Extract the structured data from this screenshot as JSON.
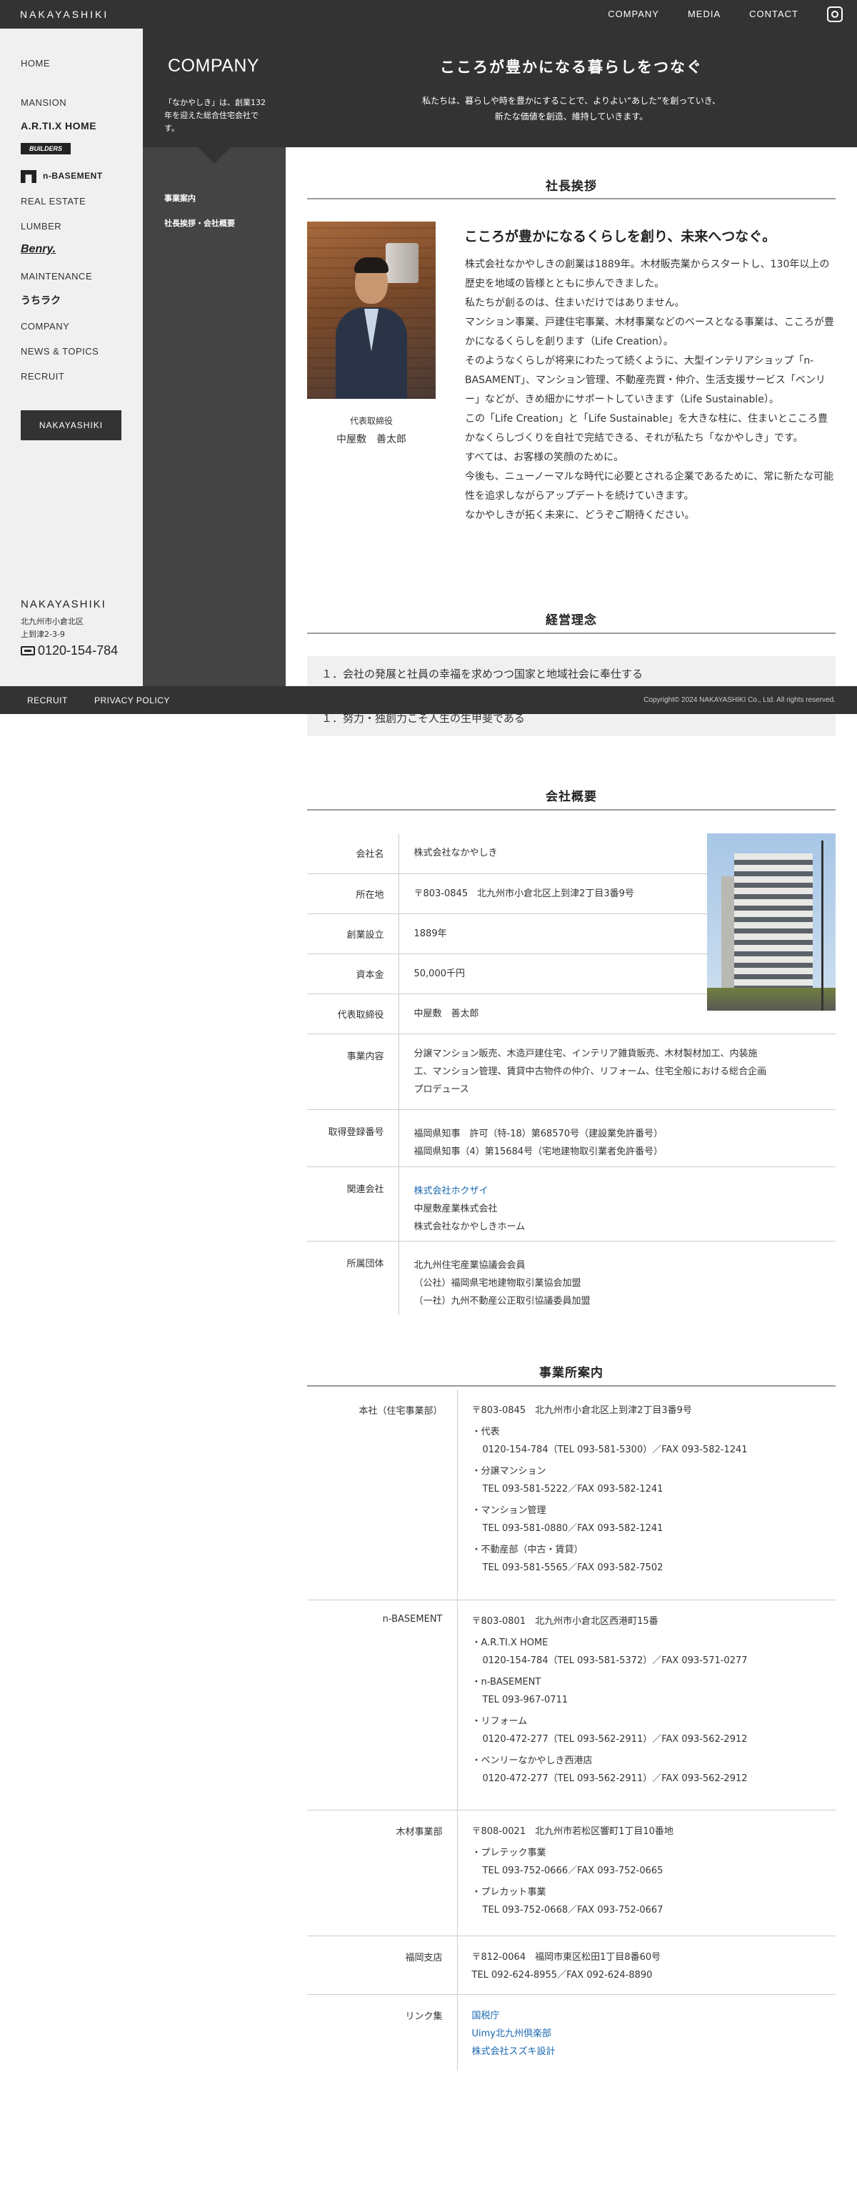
{
  "header": {
    "logo": "NAKAYASHIKI",
    "nav": [
      "COMPANY",
      "MEDIA",
      "CONTACT"
    ]
  },
  "sidebar": {
    "items": [
      "HOME",
      "MANSION",
      "REAL ESTATE",
      "LUMBER",
      "MAINTENANCE",
      "COMPANY",
      "NEWS & TOPICS",
      "RECRUIT"
    ],
    "brands": [
      "A.R.TI.X HOME",
      "BUILDERS",
      "n-BASEMENT",
      "Benry.",
      "うちラク"
    ],
    "button": "NAKAYASHIKI",
    "footer_logo": "NAKAYASHIKI",
    "address_1": "北九州市小倉北区",
    "address_2": "上到津2-3-9",
    "tel": "0120-154-784"
  },
  "hero": {
    "title": "COMPANY",
    "description": "「なかやしき」は、創業132年を迎えた総合住宅会社です。",
    "heading": "こころが豊かになる暮らしをつなぐ",
    "subline_1": "私たちは、暮らしや時を豊かにすることで、よりよい“あした”を創っていき、",
    "subline_2": "新たな価値を創造、維持していきます。"
  },
  "subnav": [
    "事業案内",
    "社長挨拶・会社概要"
  ],
  "greeting": {
    "title": "社長挨拶",
    "role": "代表取締役",
    "name": "中屋敷　善太郎",
    "heading": "こころが豊かになるくらしを創り、未来へつなぐ。",
    "body": [
      "株式会社なかやしきの創業は1889年。木材販売業からスタートし、130年以上の歴史を地域の皆様とともに歩んできました。",
      "私たちが創るのは、住まいだけではありません。",
      "マンション事業、戸建住宅事業、木材事業などのベースとなる事業は、こころが豊かになるくらしを創ります（Life Creation）。",
      "そのようなくらしが将来にわたって続くように、大型インテリアショップ「n-BASAMENT」、マンション管理、不動産売買・仲介、生活支援サービス「ベンリー」などが、きめ細かにサポートしていきます（Life Sustainable）。",
      "この「Life Creation」と「Life Sustainable」を大きな柱に、住まいとこころ豊かなくらしづくりを自社で完結できる、それが私たち「なかやしき」です。",
      "すべては、お客様の笑顔のために。",
      "今後も、ニューノーマルな時代に必要とされる企業であるために、常に新たな可能性を追求しながらアップデートを続けていきます。",
      "なかやしきが拓く未来に、どうぞご期待ください。"
    ]
  },
  "philosophy": {
    "title": "経営理念",
    "items": [
      "１．会社の発展と社員の幸福を求めつつ国家と地域社会に奉仕する",
      "１．努力・独創力こそ人生の生甲斐である"
    ]
  },
  "footer": {
    "links": [
      "RECRUIT",
      "PRIVACY POLICY"
    ],
    "copyright": "Copyright© 2024 NAKAYASHIKI Co., Ltd. All rights reserved."
  },
  "company": {
    "title": "会社概要",
    "rows": [
      {
        "k": "会社名",
        "v": [
          "株式会社なかやしき"
        ]
      },
      {
        "k": "所在地",
        "v": [
          "〒803-0845　北九州市小倉北区上到津2丁目3番9号"
        ]
      },
      {
        "k": "創業設立",
        "v": [
          "1889年"
        ]
      },
      {
        "k": "資本金",
        "v": [
          "50,000千円"
        ]
      },
      {
        "k": "代表取締役",
        "v": [
          "中屋敷　善太郎"
        ]
      },
      {
        "k": "事業内容",
        "v": [
          "分譲マンション販売、木造戸建住宅、インテリア雑貨販売、木材製材加工、内装施",
          "工、マンション管理、賃貸中古物件の仲介、リフォーム、住宅全般における総合企画",
          "プロデュース"
        ]
      },
      {
        "k": "取得登録番号",
        "v": [
          "福岡県知事　許可（特-18）第68570号（建設業免許番号）",
          "福岡県知事（4）第15684号（宅地建物取引業者免許番号）"
        ]
      },
      {
        "k": "関連会社",
        "v": [
          "株式会社ホクザイ",
          "中屋敷産業株式会社",
          "株式会社なかやしきホーム"
        ]
      },
      {
        "k": "所属団体",
        "v": [
          "北九州住宅産業協議会会員",
          "（公社）福岡県宅地建物取引業協会加盟",
          "（一社）九州不動産公正取引協議委員加盟"
        ]
      }
    ]
  },
  "offices": {
    "title": "事業所案内",
    "hq": {
      "k": "本社（住宅事業部）",
      "addr": "〒803-0845　北九州市小倉北区上到津2丁目3番9号",
      "d1": "・代表",
      "d1v": "0120-154-784（TEL 093-581-5300）／FAX 093-582-1241",
      "d2": "・分譲マンション",
      "d2v": "TEL 093-581-5222／FAX 093-582-1241",
      "d3": "・マンション管理",
      "d3v": "TEL 093-581-0880／FAX 093-582-1241",
      "d4": "・不動産部（中古・賃貸）",
      "d4v": "TEL 093-581-5565／FAX 093-582-7502"
    },
    "nb": {
      "k": "n-BASEMENT",
      "addr": "〒803-0801　北九州市小倉北区西港町15番",
      "d1": "・A.R.TI.X HOME",
      "d1v": "0120-154-784（TEL 093-581-5372）／FAX 093-571-0277",
      "d2": "・n-BASEMENT",
      "d2v": "TEL 093-967-0711",
      "d3": "・リフォーム",
      "d3v": "0120-472-277（TEL 093-562-2911）／FAX 093-562-2912",
      "d4": "・ベンリーなかやしき西港店",
      "d4v": "0120-472-277（TEL 093-562-2911）／FAX 093-562-2912"
    },
    "lumber": {
      "k": "木材事業部",
      "addr": "〒808-0021　北九州市若松区響町1丁目10番地",
      "d1": "・プレテック事業",
      "d1v": "TEL 093-752-0666／FAX 093-752-0665",
      "d2": "・プレカット事業",
      "d2v": "TEL 093-752-0668／FAX 093-752-0667"
    },
    "fukuoka": {
      "k": "福岡支店",
      "addr": "〒812-0064　福岡市東区松田1丁目8番60号",
      "tel": "TEL 092-624-8955／FAX 092-624-8890"
    },
    "links": {
      "k": "リンク集",
      "items": [
        "国税庁",
        "Uimy北九州倶楽部",
        "株式会社スズキ設計"
      ]
    }
  },
  "colors": {
    "dark": "#333333",
    "sidebar": "#f0f0f0",
    "link": "#1a68b0"
  }
}
